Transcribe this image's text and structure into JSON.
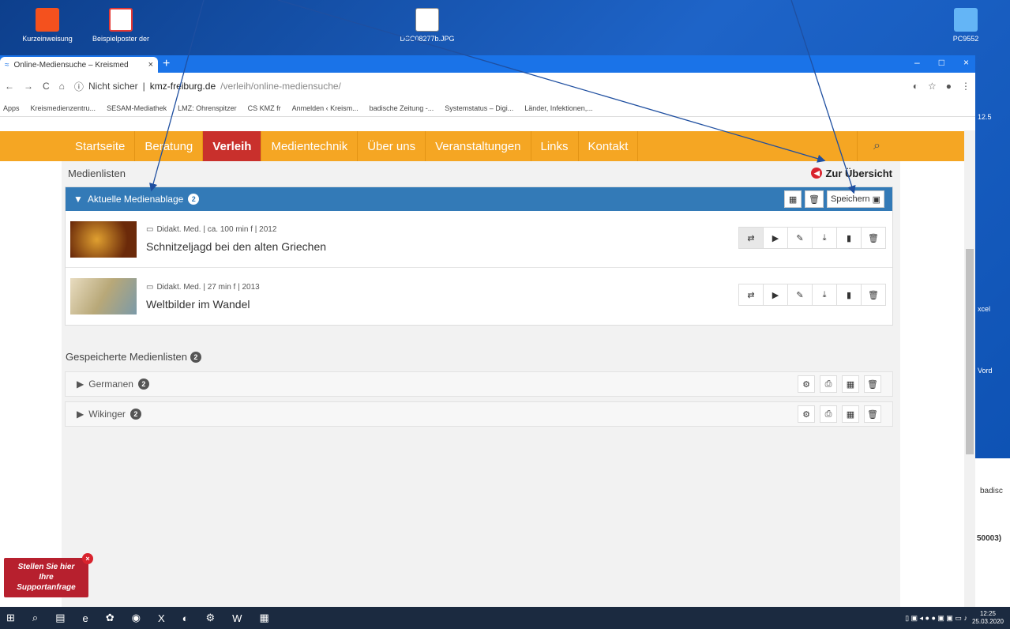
{
  "desktop": {
    "icons": [
      {
        "label": "Kurzeinweisung",
        "color": "#f4511e"
      },
      {
        "label": "Beispielposter der",
        "color": "#e53935"
      },
      {
        "label": "DSC08277b.JPG",
        "color": "#ffffff"
      },
      {
        "label": "PC9552",
        "color": "#64b5f6"
      }
    ],
    "right_partial": [
      "12.5",
      "xcel",
      "Vord",
      "badisc",
      "50003)"
    ]
  },
  "browser": {
    "tab_title": "Online-Mediensuche – Kreismed",
    "tab_close": "×",
    "newtab": "+",
    "window_controls": [
      "–",
      "□",
      "×"
    ],
    "not_secure": "Nicht sicher",
    "url_domain": "kmz-freiburg.de",
    "url_path": "/verleih/online-mediensuche/",
    "bookmarks": [
      "Apps",
      "Kreismedienzentru...",
      "SESAM-Mediathek",
      "LMZ: Ohrenspitzer",
      "CS KMZ fr",
      "Anmelden ‹ Kreism...",
      "badische Zeitung -...",
      "Systemstatus – Digi...",
      "Länder, Infektionen,..."
    ]
  },
  "nav": {
    "items": [
      "Startseite",
      "Beratung",
      "Verleih",
      "Medientechnik",
      "Über uns",
      "Veranstaltungen",
      "Links",
      "Kontakt"
    ],
    "active_index": 2,
    "search_icon": "search-icon"
  },
  "medienlisten": {
    "title": "Medienlisten",
    "back_label": "Zur Übersicht",
    "current": {
      "title": "Aktuelle Medienablage",
      "count": "2",
      "save_label": "Speichern",
      "items": [
        {
          "meta": "Didakt. Med. | ca. 100 min f | 2012",
          "title": "Schnitzeljagd bei den alten Griechen"
        },
        {
          "meta": "Didakt. Med. | 27 min f | 2013",
          "title": "Weltbilder im Wandel"
        }
      ]
    },
    "saved": {
      "title": "Gespeicherte Medienlisten",
      "count": "2",
      "lists": [
        {
          "name": "Germanen",
          "count": "2"
        },
        {
          "name": "Wikinger",
          "count": "2"
        }
      ]
    }
  },
  "support": {
    "line1": "Stellen Sie hier",
    "line2": "Ihre",
    "line3": "Supportanfrage",
    "close": "×"
  },
  "taskbar": {
    "time": "12:25",
    "date": "25.03.2020"
  }
}
